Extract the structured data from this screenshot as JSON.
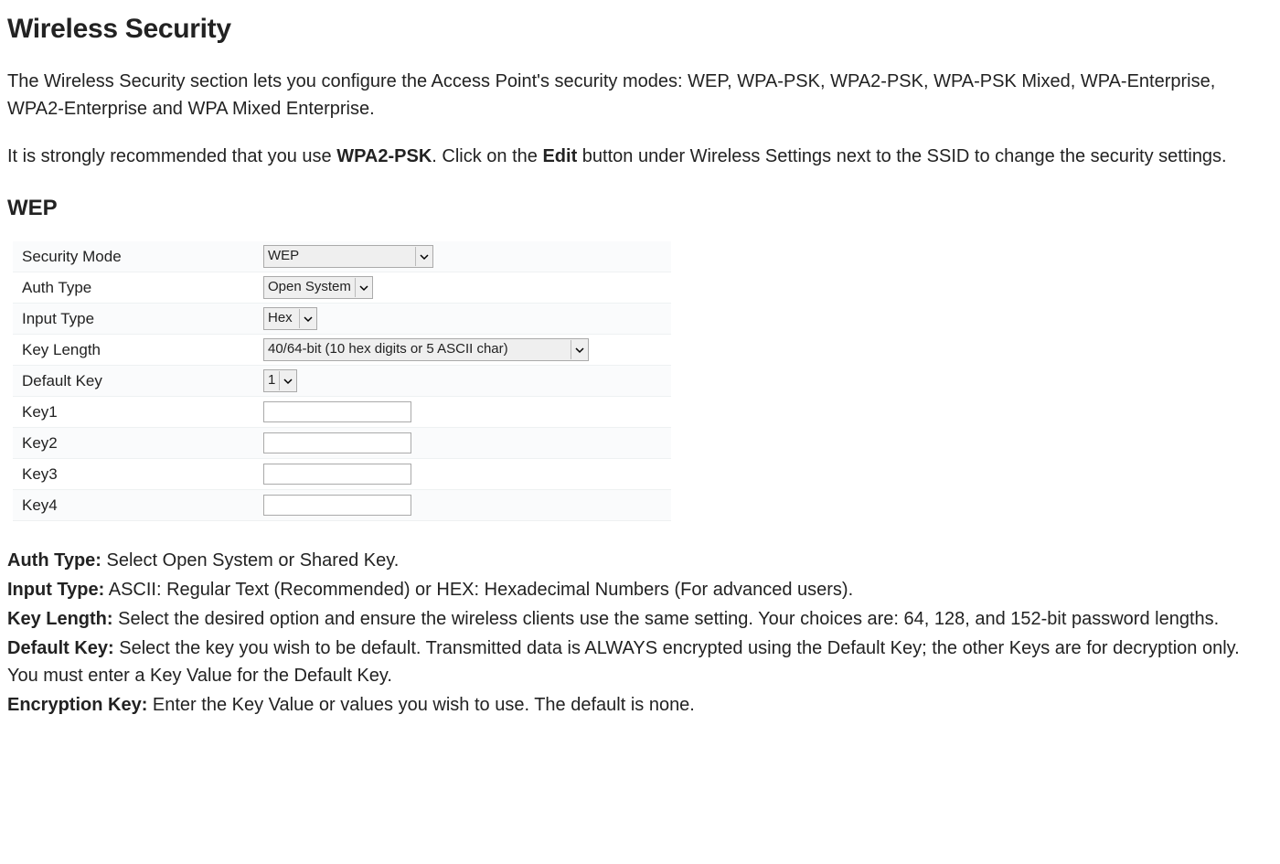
{
  "heading": "Wireless Security",
  "intro_p1": "The Wireless Security section lets you configure the Access Point's security modes: WEP, WPA-PSK, WPA2-PSK, WPA-PSK Mixed, WPA-Enterprise, WPA2-Enterprise and WPA Mixed Enterprise.",
  "intro_p2a": "It is strongly recommended that you use ",
  "intro_p2_bold1": "WPA2-PSK",
  "intro_p2b": ". Click on the ",
  "intro_p2_bold2": "Edit",
  "intro_p2c": " button under Wireless Settings next to the SSID to change the security settings.",
  "wep_heading": "WEP",
  "panel": {
    "security_mode": {
      "label": "Security Mode",
      "value": "WEP"
    },
    "auth_type": {
      "label": "Auth Type",
      "value": "Open System"
    },
    "input_type": {
      "label": "Input Type",
      "value": "Hex"
    },
    "key_length": {
      "label": "Key Length",
      "value": "40/64-bit (10 hex digits or 5 ASCII char)"
    },
    "default_key": {
      "label": "Default Key",
      "value": "1"
    },
    "key1": {
      "label": "Key1",
      "value": ""
    },
    "key2": {
      "label": "Key2",
      "value": ""
    },
    "key3": {
      "label": "Key3",
      "value": ""
    },
    "key4": {
      "label": "Key4",
      "value": ""
    }
  },
  "defs": {
    "auth_type": {
      "label": "Auth Type:",
      "text": " Select Open System or Shared Key."
    },
    "input_type": {
      "label": "Input Type:",
      "text": " ASCII: Regular Text (Recommended) or HEX: Hexadecimal Numbers (For advanced users)."
    },
    "key_length": {
      "label": "Key Length:",
      "text": " Select the desired option and ensure the wireless clients use the same setting. Your choices are: 64, 128, and 152-bit password lengths."
    },
    "default_key": {
      "label": "Default Key:",
      "text": " Select the key you wish to be default. Transmitted data is ALWAYS encrypted using the Default Key; the other Keys are for decryption only. You must enter a Key Value for the Default Key."
    },
    "encryption_key": {
      "label": "Encryption Key:",
      "text": " Enter the Key Value or values you wish to use. The default is none."
    }
  }
}
